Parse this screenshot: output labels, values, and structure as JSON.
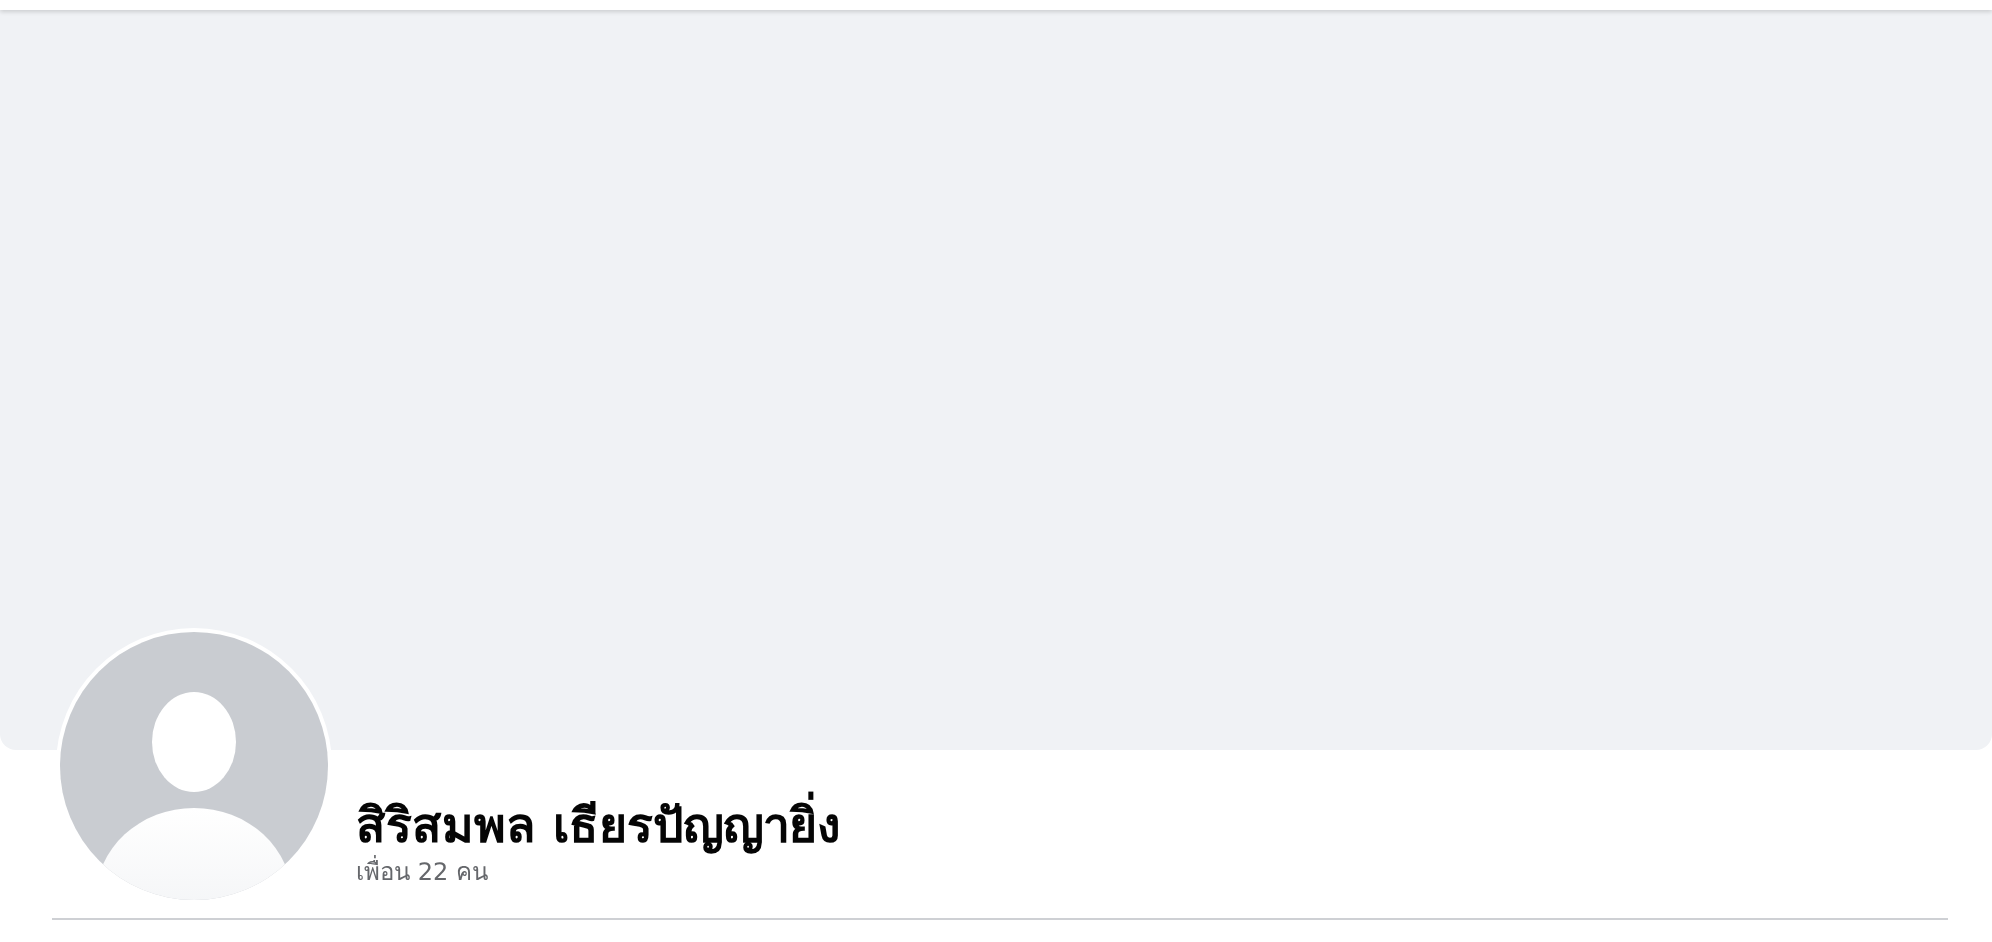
{
  "profile": {
    "name": "สิริสมพล เธียรปัญญายิ่ง",
    "friends": "เพื่อน 22 คน"
  }
}
